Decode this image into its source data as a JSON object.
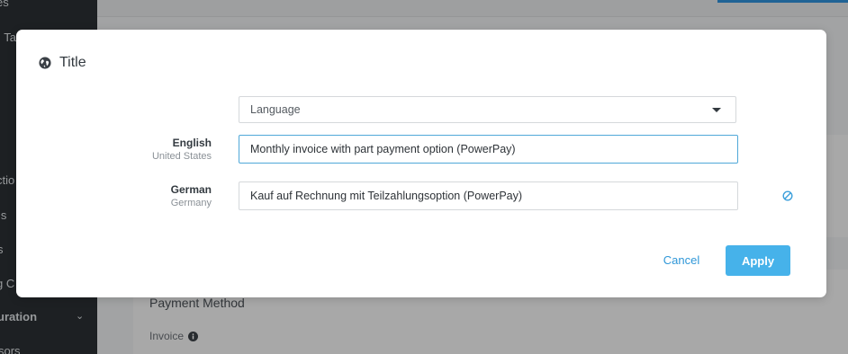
{
  "background": {
    "sidebar": {
      "items": [
        "es",
        "l Ta",
        "ctio",
        "ls",
        "s",
        "g C",
        "uration",
        "sors"
      ]
    },
    "card": {
      "title": "Payment Method",
      "subtitle": "Invoice"
    }
  },
  "modal": {
    "title": "Title",
    "language_select": {
      "value": "Language"
    },
    "rows": [
      {
        "language": "English",
        "region": "United States",
        "value": "Monthly invoice with part payment option (PowerPay)"
      },
      {
        "language": "German",
        "region": "Germany",
        "value": "Kauf auf Rechnung mit Teilzahlungsoption (PowerPay)"
      }
    ],
    "cancel_label": "Cancel",
    "apply_label": "Apply"
  },
  "colors": {
    "accent": "#46b2ea",
    "link": "#2f97d8",
    "focus_border": "#4fa8d8"
  }
}
